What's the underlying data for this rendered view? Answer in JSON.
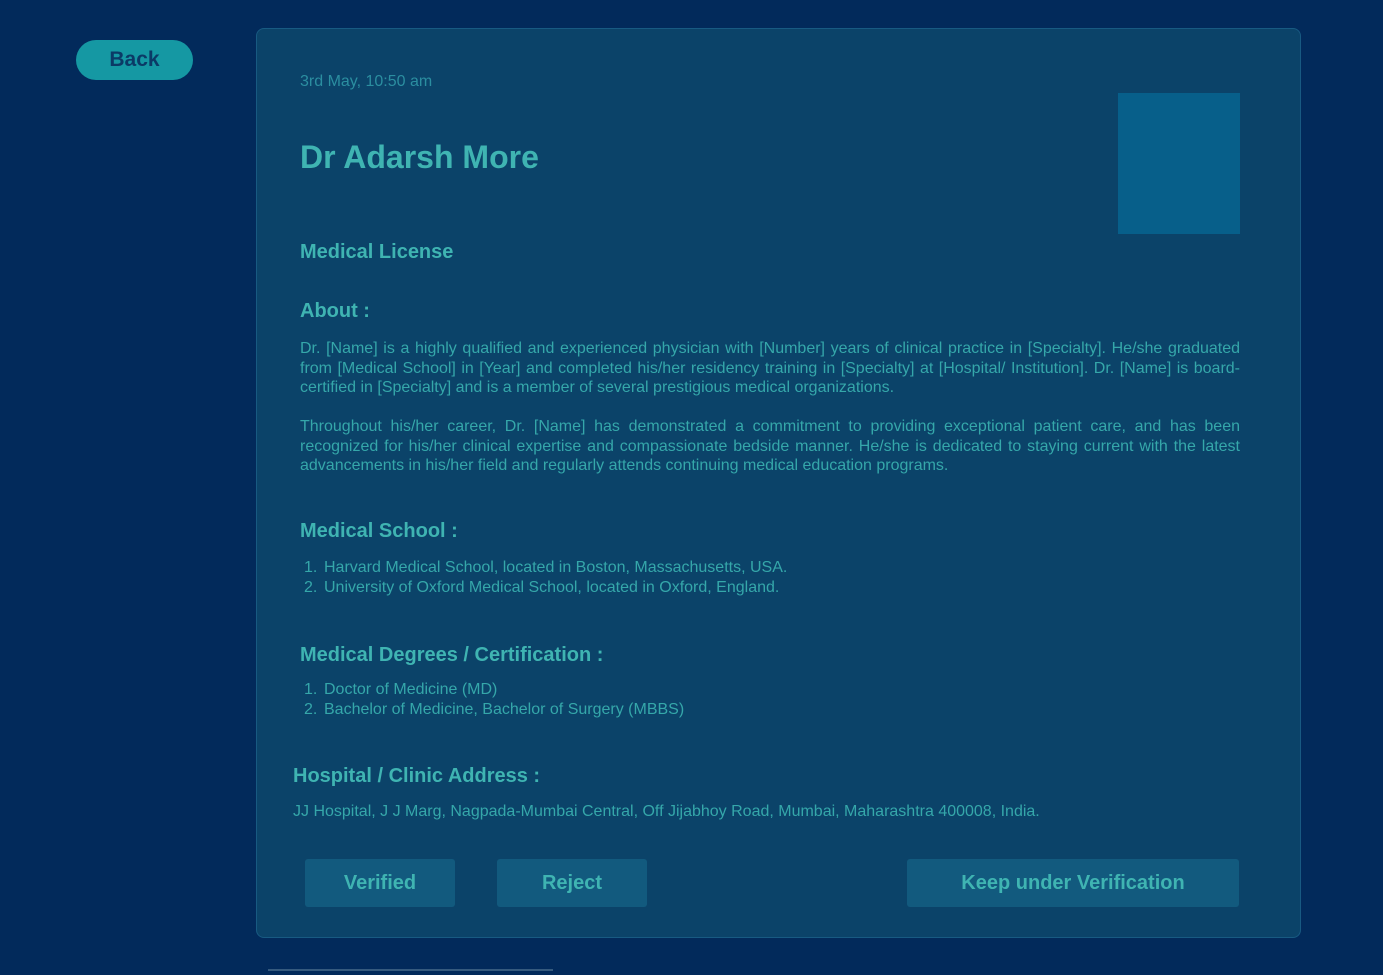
{
  "back_label": "Back",
  "datetime": "3rd May, 10:50 am",
  "doctor_name": "Dr Adarsh More",
  "license_link": "Medical License",
  "about": {
    "title": "About :",
    "paragraphs": [
      "Dr. [Name] is a highly qualified and experienced physician with [Number] years of clinical practice in [Specialty]. He/she graduated from [Medical School] in [Year] and completed his/her residency training in [Specialty] at [Hospital/ Institution]. Dr. [Name] is board-certified in [Specialty] and is a member of several prestigious medical organizations.",
      "Throughout his/her career, Dr. [Name] has demonstrated a commitment to providing exceptional patient care, and has been recognized for his/her clinical expertise and compassionate bedside manner. He/she is dedicated to staying current with the latest advancements in his/her field and regularly attends continuing medical education programs."
    ]
  },
  "medical_school": {
    "title": "Medical School :",
    "items": [
      {
        "num": "1.",
        "text": "Harvard Medical School, located in Boston, Massachusetts, USA."
      },
      {
        "num": "2.",
        "text": "University of Oxford Medical School, located in Oxford, England."
      }
    ]
  },
  "degrees": {
    "title": "Medical Degrees / Certification :",
    "items": [
      {
        "num": "1.",
        "text": "Doctor of Medicine (MD)"
      },
      {
        "num": "2.",
        "text": "Bachelor of Medicine, Bachelor of Surgery (MBBS)"
      }
    ]
  },
  "address": {
    "title": "Hospital / Clinic Address :",
    "text": "JJ Hospital, J J Marg, Nagpada-Mumbai Central, Off Jijabhoy Road, Mumbai, Maharashtra 400008, India."
  },
  "actions": {
    "verified": "Verified",
    "reject": "Reject",
    "keep": "Keep under Verification"
  },
  "colors": {
    "background": "#022a5b",
    "card": "#0b4369",
    "accent": "#1598a3",
    "text": "#3fb4b2"
  }
}
